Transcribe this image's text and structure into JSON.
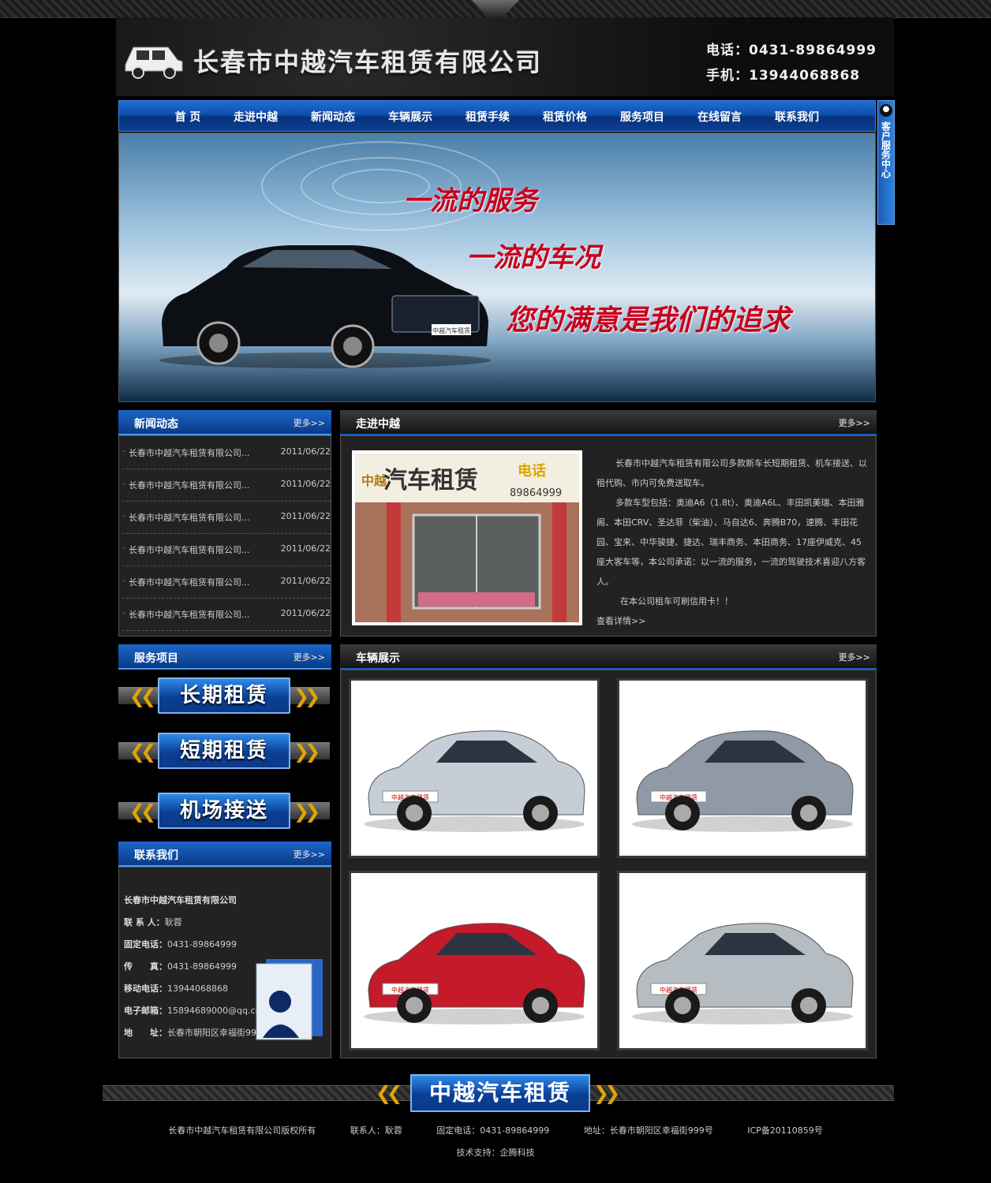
{
  "header": {
    "company": "长春市中越汽车租赁有限公司",
    "phone": "电话：0431-89864999",
    "mobile": "手机：13944068868"
  },
  "nav": [
    "首 页",
    "走进中越",
    "新闻动态",
    "车辆展示",
    "租赁手续",
    "租赁价格",
    "服务项目",
    "在线留言",
    "联系我们"
  ],
  "side_tab": "客户服务中心",
  "banner": {
    "slogan1": "一流的服务",
    "slogan2": "一流的车况",
    "slogan3": "您的满意是我们的追求",
    "plate": "中越汽车租赁"
  },
  "news": {
    "title": "新闻动态",
    "more": "更多>>",
    "items": [
      {
        "text": "长春市中越汽车租赁有限公司...",
        "date": "2011/06/22"
      },
      {
        "text": "长春市中越汽车租赁有限公司...",
        "date": "2011/06/22"
      },
      {
        "text": "长春市中越汽车租赁有限公司...",
        "date": "2011/06/22"
      },
      {
        "text": "长春市中越汽车租赁有限公司...",
        "date": "2011/06/22"
      },
      {
        "text": "长春市中越汽车租赁有限公司...",
        "date": "2011/06/22"
      },
      {
        "text": "长春市中越汽车租赁有限公司...",
        "date": "2011/06/22"
      }
    ]
  },
  "about": {
    "title": "走进中越",
    "more": "更多>>",
    "sign_left": "中越",
    "sign_main": "汽车租赁",
    "sign_tel": "电话",
    "sign_num": "89864999",
    "p1": "长春市中越汽车租赁有限公司多款新车长短期租赁、机车接送、以租代购、市内可免费送取车。",
    "p2": "多款车型包括：奥迪A6（1.8t）、奥迪A6L、丰田凯美瑞、本田雅阁、本田CRV、圣达菲（柴油）、马自达6、奔腾B70，速腾、丰田花园、宝来、中华骏捷、捷达、瑞丰商务、本田商务、17座伊威克、45座大客车等，本公司承诺：以一流的服务，一流的驾驶技术喜迎八方客人。",
    "p3": "在本公司租车可刷信用卡！！",
    "detail": "查看详情>>"
  },
  "services": {
    "title": "服务项目",
    "more": "更多>>",
    "items": [
      "长期租赁",
      "短期租赁",
      "机场接送"
    ]
  },
  "contact": {
    "title": "联系我们",
    "more": "更多>>",
    "company": "长春市中越汽车租赁有限公司",
    "person_label": "联 系 人：",
    "person": "耿蓉",
    "tel_label": "固定电话：",
    "tel": "0431-89864999",
    "fax_label": "传　　真：",
    "fax": "0431-89864999",
    "mobile_label": "移动电话：",
    "mobile": "13944068868",
    "email_label": "电子邮箱：",
    "email": "15894689000@qq.com",
    "addr_label": "地　　址：",
    "addr": "长春市朝阳区幸福街999号"
  },
  "vehicles": {
    "title": "车辆展示",
    "more": "更多>>",
    "plate": "中越汽车租赁",
    "colors": [
      "#c5ced6",
      "#8f9aa6",
      "#c41a2a",
      "#b5bcc2"
    ]
  },
  "footer": {
    "badge": "中越汽车租赁",
    "copyright": "长春市中越汽车租赁有限公司版权所有",
    "contact": "联系人：耿蓉",
    "tel": "固定电话：0431-89864999",
    "addr": "地址：长春市朝阳区幸福街999号",
    "icp": "ICP备20110859号",
    "support": "技术支持：企腾科技"
  }
}
